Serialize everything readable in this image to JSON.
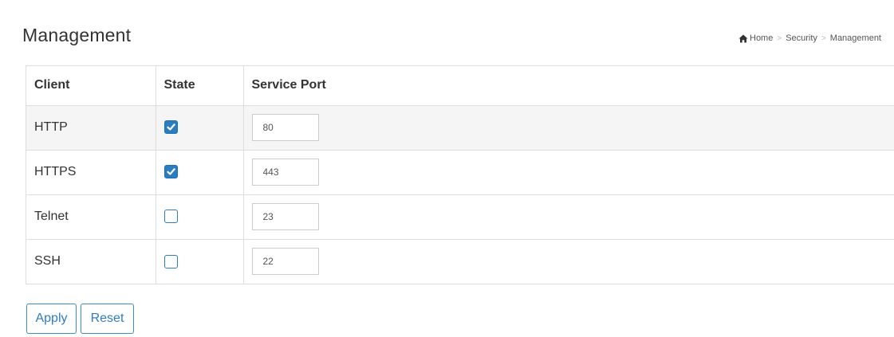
{
  "page": {
    "title": "Management"
  },
  "breadcrumb": {
    "icon": "home-icon",
    "items": [
      "Home",
      "Security",
      "Management"
    ],
    "separator": ">"
  },
  "table": {
    "columns": [
      "Client",
      "State",
      "Service Port"
    ],
    "rows": [
      {
        "client": "HTTP",
        "state": true,
        "port": "80"
      },
      {
        "client": "HTTPS",
        "state": true,
        "port": "443"
      },
      {
        "client": "Telnet",
        "state": false,
        "port": "23"
      },
      {
        "client": "SSH",
        "state": false,
        "port": "22"
      }
    ]
  },
  "buttons": {
    "apply": "Apply",
    "reset": "Reset"
  },
  "colors": {
    "accent": "#2f7dbd",
    "checkbox_checked": "#2b7dbe",
    "row_highlight": "#f5f5f5",
    "border": "#dddddd"
  }
}
